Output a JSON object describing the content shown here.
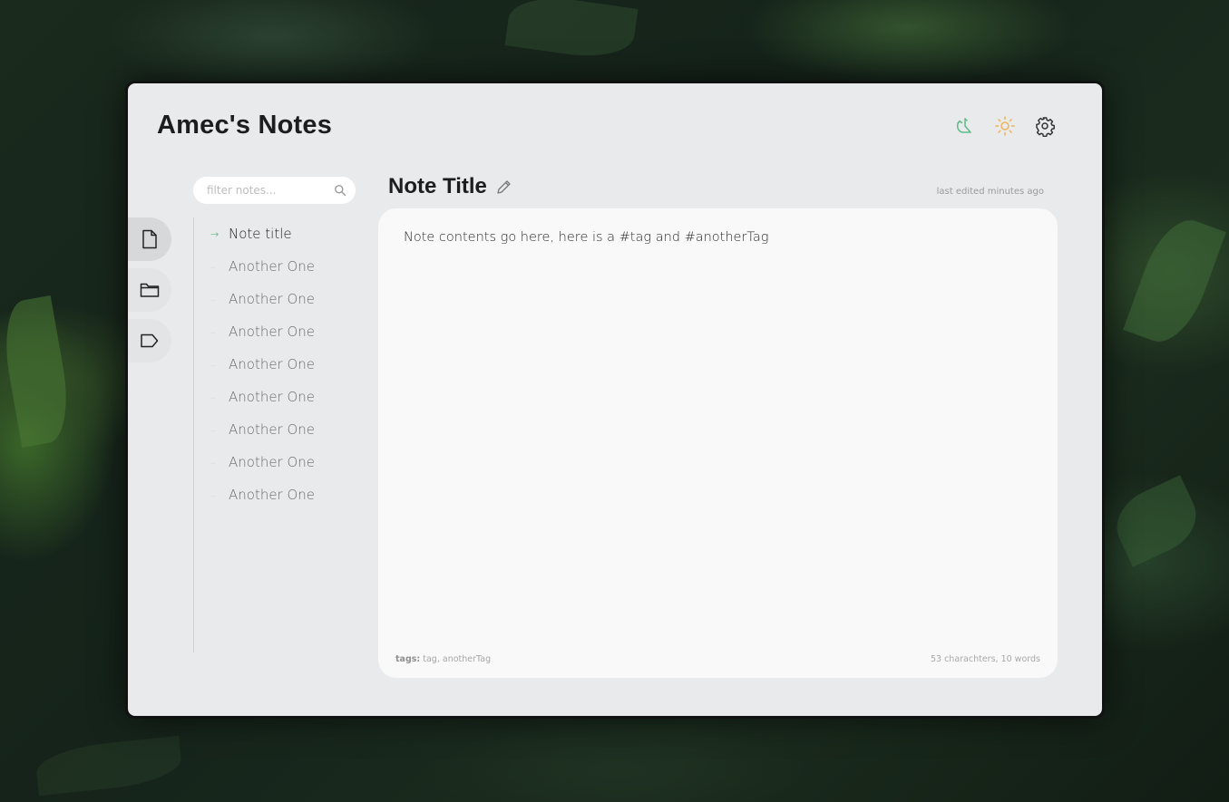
{
  "app": {
    "title": "Amec's Notes",
    "icons": [
      "sync-icon",
      "sun-icon",
      "gear-icon"
    ]
  },
  "sidebar": {
    "tabs": [
      {
        "icon": "file-icon",
        "active": true
      },
      {
        "icon": "folder-icon",
        "active": false
      },
      {
        "icon": "tag-icon",
        "active": false
      }
    ]
  },
  "search": {
    "placeholder": "filter notes...",
    "value": ""
  },
  "notes": [
    {
      "title": "Note title",
      "active": true
    },
    {
      "title": "Another One",
      "active": false
    },
    {
      "title": "Another One",
      "active": false
    },
    {
      "title": "Another One",
      "active": false
    },
    {
      "title": "Another One",
      "active": false
    },
    {
      "title": "Another One",
      "active": false
    },
    {
      "title": "Another One",
      "active": false
    },
    {
      "title": "Another One",
      "active": false
    },
    {
      "title": "Another One",
      "active": false
    }
  ],
  "editor": {
    "title": "Note Title",
    "last_edited": "last edited minutes ago",
    "content": "Note contents go here, here is a #tag and #anotherTag",
    "tags_label": "tags:",
    "tags_value": "tag, anotherTag",
    "stats": "53 charachters, 10 words"
  },
  "colors": {
    "accent": "#3fae6b",
    "sun": "#f0b55a",
    "sync": "#5fba86"
  }
}
